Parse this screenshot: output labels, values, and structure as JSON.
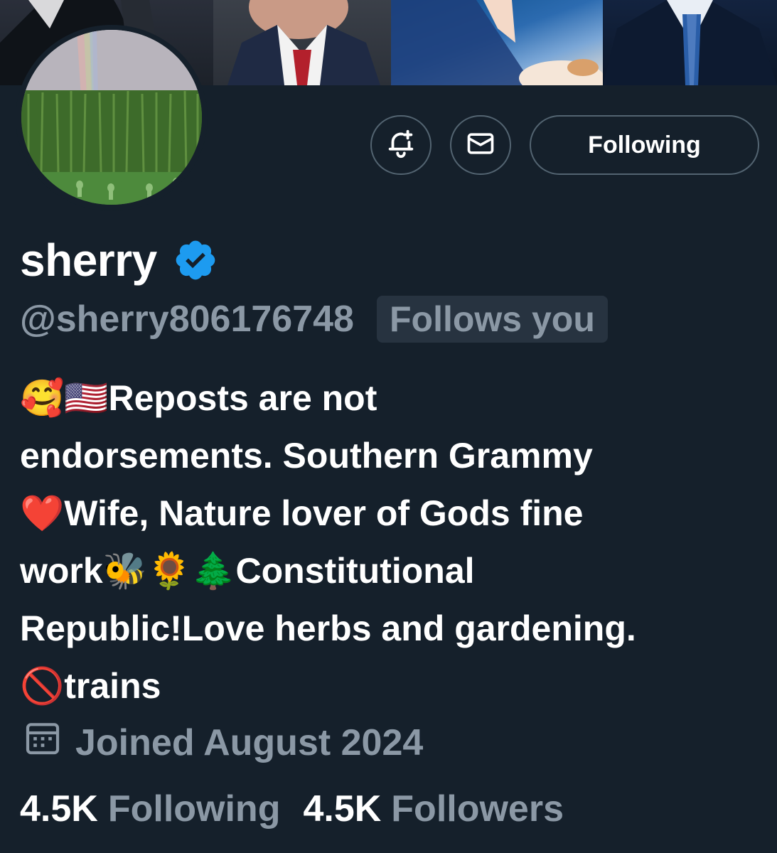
{
  "profile": {
    "display_name": "sherry",
    "handle": "@sherry806176748",
    "follows_you_label": "Follows you",
    "verified": true
  },
  "actions": {
    "notify_icon": "bell-plus-icon",
    "message_icon": "envelope-icon",
    "following_label": "Following"
  },
  "bio": {
    "line1_emoji": "🥰🇺🇸",
    "line1_text": "Reposts are not",
    "line2_text": "endorsements. Southern Grammy",
    "line3_emoji": "❤️",
    "line3_text": "Wife, Nature lover of Gods fine",
    "line4_text_a": "work",
    "line4_emoji": "🐝🌻🌲",
    "line4_text_b": "Constitutional",
    "line5_text": "Republic!Love herbs and gardening.",
    "line6_emoji": "🚫",
    "line6_text": "trains"
  },
  "joined": {
    "icon": "calendar-icon",
    "text": "Joined August 2024"
  },
  "stats": {
    "following_count": "4.5K",
    "following_label": "Following",
    "followers_count": "4.5K",
    "followers_label": "Followers"
  },
  "colors": {
    "background": "#15202b",
    "muted_text": "#8b98a5",
    "verified_blue": "#1d9bf0",
    "button_border": "#536471"
  }
}
